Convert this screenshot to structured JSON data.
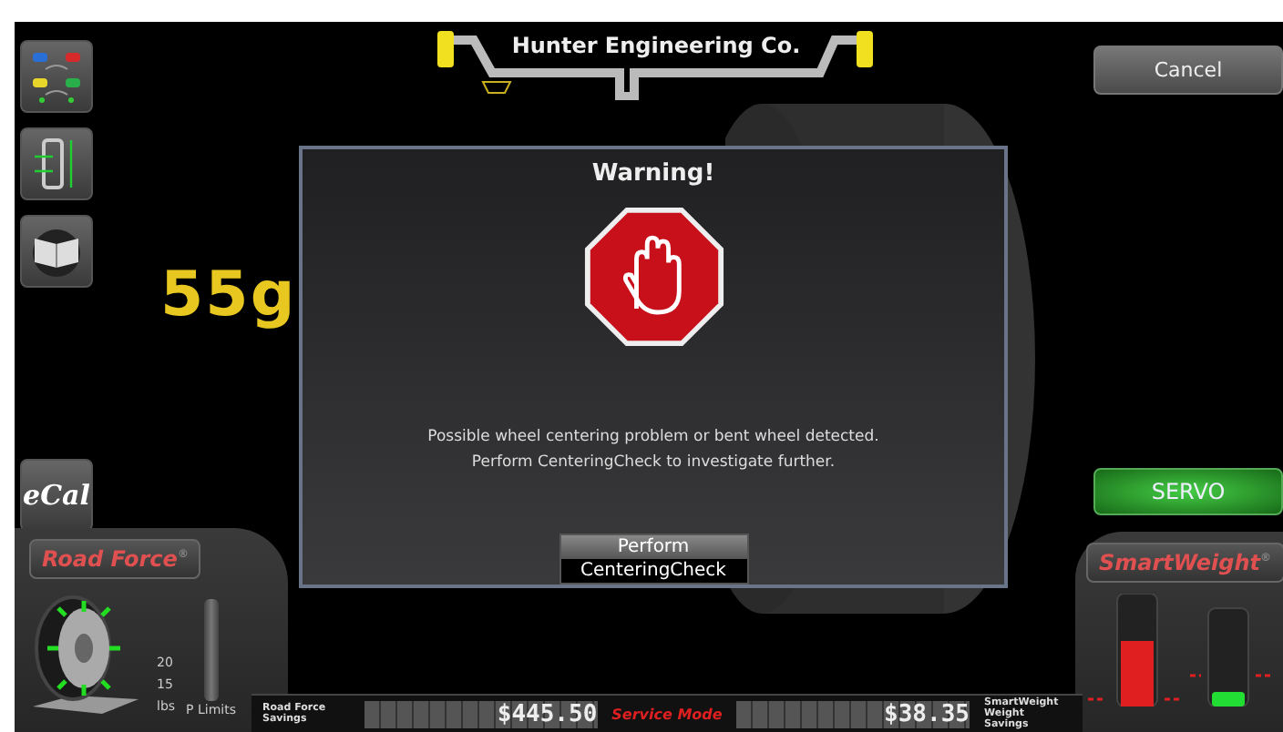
{
  "header": {
    "title": "Hunter Engineering Co."
  },
  "cancel_button": "Cancel",
  "weight_reading": "55g",
  "dialog": {
    "title": "Warning!",
    "message": [
      "Possible wheel centering problem or bent wheel detected.",
      "Perform CenteringCheck to investigate further."
    ],
    "button": [
      "Perform",
      "CenteringCheck"
    ]
  },
  "ecal_button": "eCal",
  "servo_button": "SERVO",
  "road_force": {
    "label": "Road Force$^{®}$",
    "scale": [
      "20",
      "15",
      "lbs"
    ],
    "limits_label": "P Limits"
  },
  "smartweight": {
    "label": "SmartWeight$^{®}$"
  },
  "footer": {
    "road_force_savings_label": "Road Force Savings",
    "road_force_savings": "$445.50",
    "mode": "Service Mode",
    "smartweight_savings": "$38.35",
    "smartweight_savings_label": "SmartWeight Weight Savings"
  }
}
